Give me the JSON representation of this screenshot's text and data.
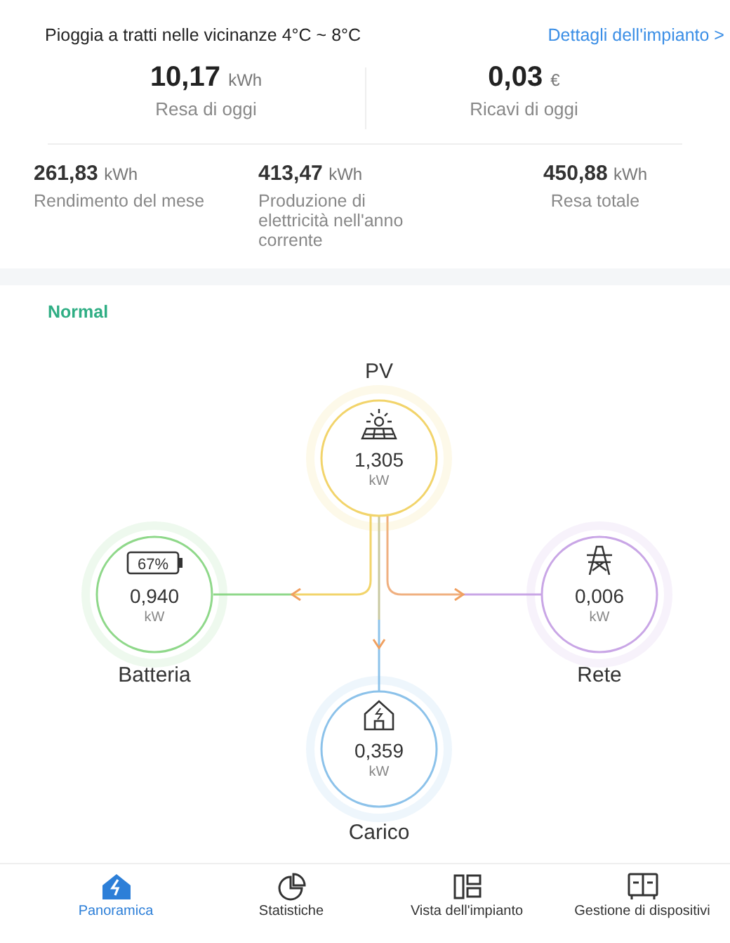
{
  "header": {
    "weather": "Pioggia a tratti nelle vicinanze 4°C ~ 8°C",
    "details_link": "Dettagli dell'impianto >"
  },
  "today": [
    {
      "value": "10,17",
      "unit": "kWh",
      "label": "Resa di oggi"
    },
    {
      "value": "0,03",
      "unit": "€",
      "label": "Ricavi di oggi"
    }
  ],
  "totals": [
    {
      "value": "261,83",
      "unit": "kWh",
      "label": "Rendimento del mese"
    },
    {
      "value": "413,47",
      "unit": "kWh",
      "label": "Produzione di elettricità nell'anno corrente"
    },
    {
      "value": "450,88",
      "unit": "kWh",
      "label": "Resa totale"
    }
  ],
  "status": "Normal",
  "flow_nodes": [
    {
      "kind": "pv",
      "label": "PV",
      "value": "1,305",
      "unit": "kW",
      "color": "#f2d46b"
    },
    {
      "kind": "battery",
      "label": "Batteria",
      "value": "0,940",
      "unit": "kW",
      "battery_percent": "67%",
      "color": "#8fd88a"
    },
    {
      "kind": "grid",
      "label": "Rete",
      "value": "0,006",
      "unit": "kW",
      "color": "#c9a6e6"
    },
    {
      "kind": "load",
      "label": "Carico",
      "value": "0,359",
      "unit": "kW",
      "color": "#8cc2ea"
    }
  ],
  "tabs": [
    {
      "label": "Panoramica",
      "selected": true
    },
    {
      "label": "Statistiche",
      "selected": false
    },
    {
      "label": "Vista dell'impianto",
      "selected": false
    },
    {
      "label": "Gestione di dispositivi",
      "selected": false
    }
  ]
}
